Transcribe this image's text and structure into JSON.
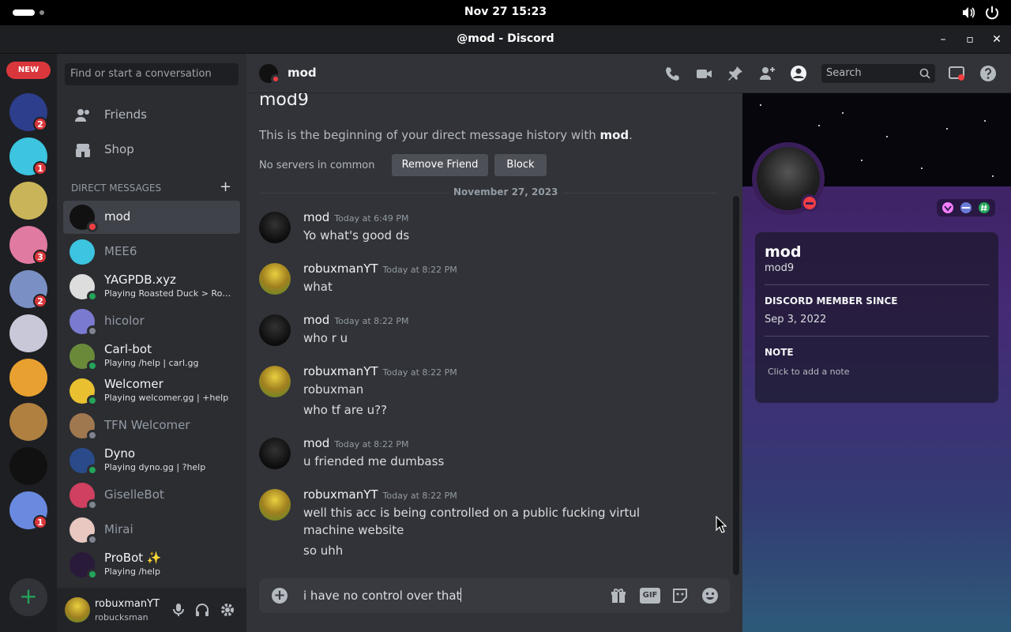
{
  "system": {
    "clock": "Nov 27  15:23"
  },
  "window": {
    "title": "@mod - Discord",
    "minimize": "–",
    "maximize": "▫",
    "close": "✕"
  },
  "rail": {
    "new_badge": "NEW",
    "servers": [
      {
        "name": "server-1",
        "badge": "2",
        "color": "#2c3e8c"
      },
      {
        "name": "server-2",
        "badge": "1",
        "color": "#3cc4e0"
      },
      {
        "name": "server-3",
        "badge": "",
        "color": "#c9b45a"
      },
      {
        "name": "server-4",
        "badge": "3",
        "color": "#e07aa0"
      },
      {
        "name": "server-5",
        "badge": "2",
        "color": "#7a8fc4"
      },
      {
        "name": "server-6",
        "badge": "",
        "color": "#c8c8d8"
      },
      {
        "name": "server-7",
        "badge": "",
        "color": "#e8a030"
      },
      {
        "name": "server-8",
        "badge": "",
        "color": "#b08040"
      },
      {
        "name": "server-9",
        "badge": "",
        "color": "#111111"
      },
      {
        "name": "server-10",
        "badge": "1",
        "color": "#6a8ae0"
      },
      {
        "name": "server-11",
        "badge": "",
        "color": "#1e1f22"
      }
    ],
    "add_label": "+"
  },
  "dm_sidebar": {
    "search_placeholder": "Find or start a conversation",
    "nav": [
      {
        "label": "Friends"
      },
      {
        "label": "Shop"
      }
    ],
    "header": "DIRECT MESSAGES",
    "add_label": "+",
    "items": [
      {
        "name": "mod",
        "sub": "",
        "status": "dnd",
        "color": "#111111",
        "active": true
      },
      {
        "name": "MEE6",
        "sub": "",
        "status": "",
        "color": "#3cc4e0"
      },
      {
        "name": "YAGPDB.xyz",
        "sub": "Playing Roasted Duck > Roast...",
        "status": "on",
        "color": "#dddddd"
      },
      {
        "name": "hicolor",
        "sub": "",
        "status": "off",
        "color": "#7a7ad0"
      },
      {
        "name": "Carl-bot",
        "sub": "Playing /help | carl.gg",
        "status": "on",
        "color": "#6a8a3a"
      },
      {
        "name": "Welcomer",
        "sub": "Playing welcomer.gg | +help",
        "status": "on",
        "color": "#e8c030"
      },
      {
        "name": "TFN Welcomer",
        "sub": "",
        "status": "off",
        "color": "#a07850"
      },
      {
        "name": "Dyno",
        "sub": "Playing dyno.gg | ?help",
        "status": "on",
        "color": "#2a4a8a"
      },
      {
        "name": "GiselleBot",
        "sub": "",
        "status": "off",
        "color": "#d04060"
      },
      {
        "name": "Mirai",
        "sub": "",
        "status": "off",
        "color": "#e8c8c0"
      },
      {
        "name": "ProBot ✨",
        "sub": "Playing /help",
        "status": "on",
        "color": "#2a1a3a"
      }
    ]
  },
  "user": {
    "name": "robuxmanYT",
    "handle": "robucksman"
  },
  "chat": {
    "header_name": "mod",
    "search_placeholder": "Search",
    "intro_name": "mod9",
    "intro_prefix": "This is the beginning of your direct message history with ",
    "intro_user": "mod",
    "intro_suffix": ".",
    "no_servers": "No servers in common",
    "remove_friend": "Remove Friend",
    "block": "Block",
    "date_divider": "November 27, 2023",
    "messages": [
      {
        "author": "mod",
        "time": "Today at 6:49 PM",
        "lines": [
          "Yo what's good ds"
        ]
      },
      {
        "author": "robuxmanYT",
        "time": "Today at 8:22 PM",
        "lines": [
          "what"
        ]
      },
      {
        "author": "mod",
        "time": "Today at 8:22 PM",
        "lines": [
          "who r u"
        ]
      },
      {
        "author": "robuxmanYT",
        "time": "Today at 8:22 PM",
        "lines": [
          "robuxman",
          "who tf are u??"
        ]
      },
      {
        "author": "mod",
        "time": "Today at 8:22 PM",
        "lines": [
          "u friended me dumbass"
        ]
      },
      {
        "author": "robuxmanYT",
        "time": "Today at 8:22 PM",
        "lines": [
          "well this acc is being controlled on a public fucking virtul machine website",
          "so uhh"
        ]
      }
    ],
    "composer_text": "i have no control over that",
    "gif_label": "GIF"
  },
  "profile": {
    "display_name": "mod",
    "username": "mod9",
    "member_since_label": "DISCORD MEMBER SINCE",
    "member_since": "Sep 3, 2022",
    "note_label": "NOTE",
    "note_placeholder": "Click to add a note"
  }
}
